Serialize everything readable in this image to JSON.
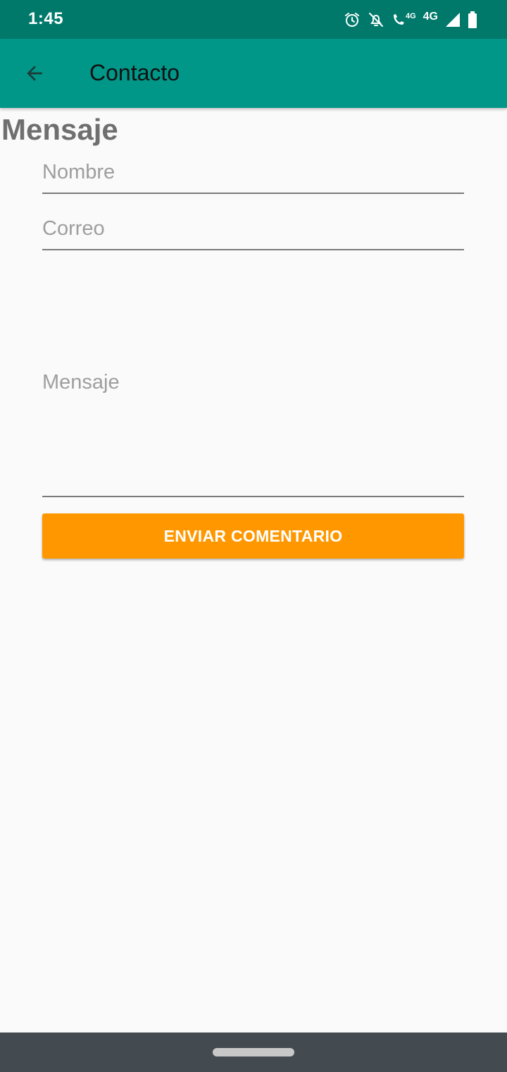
{
  "status_bar": {
    "time": "1:45",
    "icons": [
      "alarm-icon",
      "notifications-off-icon",
      "volte-call-icon",
      "network-4g-icon",
      "signal-icon",
      "battery-icon"
    ],
    "call_network_label": "4G",
    "network_label": "4G"
  },
  "app_bar": {
    "title": "Contacto",
    "back_icon": "arrow-back-icon"
  },
  "form": {
    "section_title": "Mensaje",
    "name_placeholder": "Nombre",
    "email_placeholder": "Correo",
    "message_placeholder": "Mensaje",
    "submit_label": "ENVIAR COMENTARIO"
  },
  "colors": {
    "status_bar": "#00796b",
    "app_bar": "#009688",
    "accent_button": "#ff9800",
    "nav_bar": "#434a50",
    "background": "#fafafa"
  }
}
